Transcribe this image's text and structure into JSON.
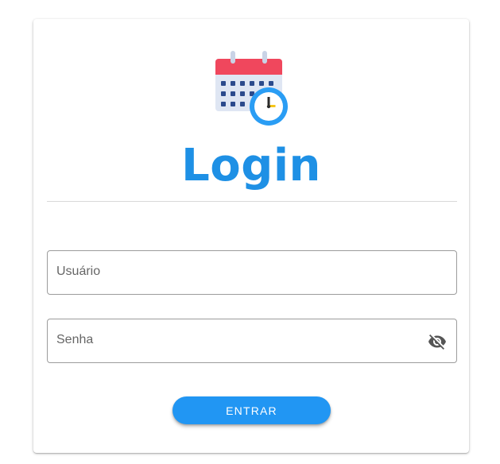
{
  "login": {
    "title": "Login",
    "username_label": "Usuário",
    "password_label": "Senha",
    "submit_label": "ENTRAR",
    "logo_icon": "calendar-clock-icon",
    "password_toggle_icon": "eye-off-icon"
  },
  "colors": {
    "title": "#1e90e5",
    "button": "#2196f3",
    "calendar_header": "#f0475d",
    "clock": "#2a9df4"
  }
}
